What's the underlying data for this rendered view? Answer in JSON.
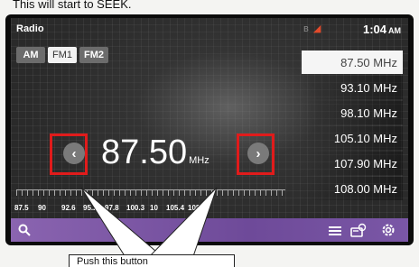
{
  "caption": {
    "top": "This will start to SEEK.",
    "callout": "Push this button"
  },
  "header": {
    "title": "Radio",
    "time": "1:04",
    "ampm": "AM"
  },
  "bands": [
    {
      "label": "AM",
      "active": false
    },
    {
      "label": "FM1",
      "active": true
    },
    {
      "label": "FM2",
      "active": false
    }
  ],
  "tuner": {
    "frequency": "87.50",
    "unit": "MHz"
  },
  "scale": [
    "87.5",
    "90",
    "92.6",
    "95.2",
    "97.8",
    "100.3",
    "10",
    "105.4",
    "108.0"
  ],
  "presets": [
    "87.50 MHz",
    "93.10 MHz",
    "98.10 MHz",
    "105.10 MHz",
    "107.90 MHz",
    "108.00 MHz"
  ],
  "icons": {
    "seek_prev": "chevron-left-icon",
    "seek_next": "chevron-right-icon",
    "search": "search-icon",
    "list": "list-icon",
    "source": "audio-source-icon",
    "settings": "gear-icon"
  },
  "colors": {
    "highlight": "#e01b1b",
    "bottom_bar": "#7a57a6"
  }
}
